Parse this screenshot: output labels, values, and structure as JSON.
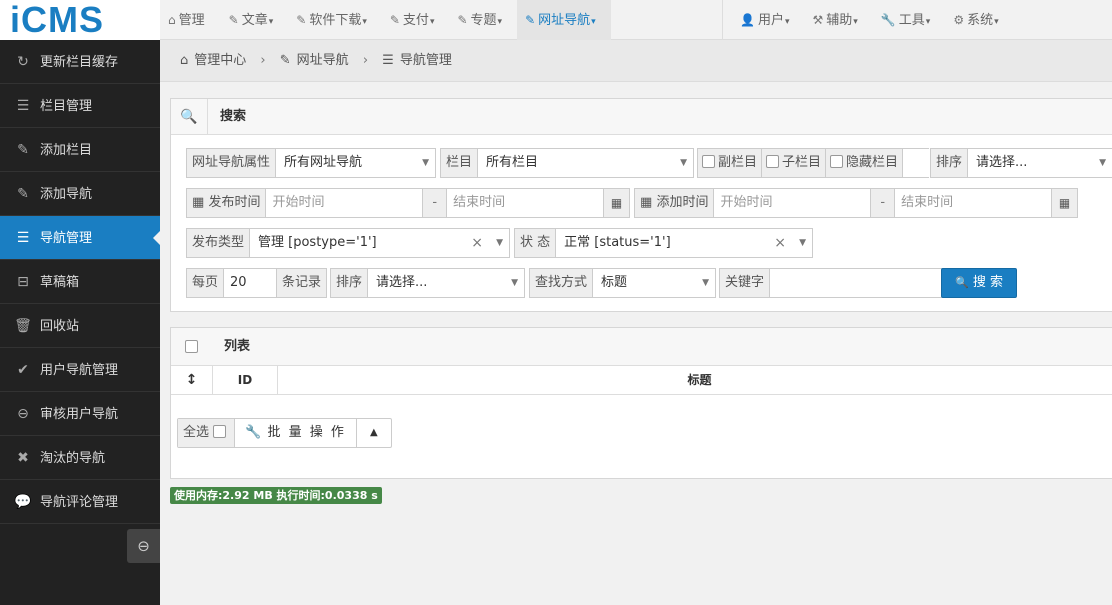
{
  "logo": "iCMS",
  "nav_left": [
    {
      "icon": "⌂",
      "label": "管理",
      "caret": ""
    },
    {
      "icon": "✎",
      "label": "文章",
      "caret": "▾"
    },
    {
      "icon": "✎",
      "label": "软件下载",
      "caret": "▾"
    },
    {
      "icon": "✎",
      "label": "支付",
      "caret": "▾"
    },
    {
      "icon": "✎",
      "label": "专题",
      "caret": "▾"
    },
    {
      "icon": "✎",
      "label": "网址导航",
      "caret": "▾"
    }
  ],
  "nav_right": [
    {
      "icon": "👤",
      "label": "用户",
      "caret": "▾"
    },
    {
      "icon": "⚒",
      "label": "辅助",
      "caret": "▾"
    },
    {
      "icon": "🔧",
      "label": "工具",
      "caret": "▾"
    },
    {
      "icon": "⚙",
      "label": "系统",
      "caret": "▾"
    }
  ],
  "sidebar": [
    {
      "icon": "↻",
      "label": "更新栏目缓存"
    },
    {
      "icon": "☰",
      "label": "栏目管理"
    },
    {
      "icon": "✎",
      "label": "添加栏目"
    },
    {
      "icon": "✎",
      "label": "添加导航"
    },
    {
      "icon": "☰",
      "label": "导航管理"
    },
    {
      "icon": "⊟",
      "label": "草稿箱"
    },
    {
      "icon": "🗑",
      "label": "回收站"
    },
    {
      "icon": "✔",
      "label": "用户导航管理"
    },
    {
      "icon": "⊖",
      "label": "审核用户导航"
    },
    {
      "icon": "✖",
      "label": "淘汰的导航"
    },
    {
      "icon": "💬",
      "label": "导航评论管理"
    }
  ],
  "sidebar_collapse_icon": "⊖",
  "breadcrumb": {
    "home_icon": "⌂",
    "home": "管理中心",
    "sep": "›",
    "level1_icon": "✎",
    "level1": "网址导航",
    "level2_icon": "☰",
    "level2": "导航管理"
  },
  "search": {
    "title": "搜索",
    "icon": "🔍",
    "attr_label": "网址导航属性",
    "attr_value": "所有网址导航",
    "cat_label": "栏目",
    "cat_value": "所有栏目",
    "chk_sub": "副栏目",
    "chk_child": "子栏目",
    "chk_hidden": "隐藏栏目",
    "sort_label": "排序",
    "sort_value": "请选择...",
    "pub_time_label": "发布时间",
    "pub_start_placeholder": "开始时间",
    "pub_end_placeholder": "结束时间",
    "range_dash": "-",
    "add_time_label": "添加时间",
    "add_start_placeholder": "开始时间",
    "add_end_placeholder": "结束时间",
    "pub_type_label": "发布类型",
    "pub_type_value": "管理 [postype='1']",
    "status_label": "状 态",
    "status_value": "正常 [status='1']",
    "per_page_label": "每页",
    "per_page_value": "20",
    "per_page_suffix": "条记录",
    "sort2_label": "排序",
    "sort2_value": "请选择...",
    "find_mode_label": "查找方式",
    "find_mode_value": "标题",
    "keyword_label": "关键字",
    "keyword_value": "",
    "search_button": "搜 索",
    "calendar_icon": "▦",
    "clear_icon": "×",
    "arrow_icon": "▼"
  },
  "list": {
    "title": "列表",
    "col_sort_icon": "↕",
    "col_id": "ID",
    "col_title": "标题",
    "select_all": "全选",
    "batch_icon": "🔧",
    "batch_label": "批 量 操 作",
    "toggle_icon": "▲"
  },
  "footer_badge": "使用内存:2.92 MB 执行时间:0.0338 s"
}
